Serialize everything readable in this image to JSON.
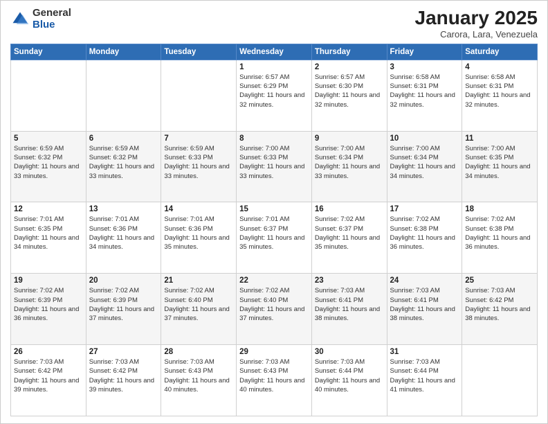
{
  "header": {
    "logo_general": "General",
    "logo_blue": "Blue",
    "month_title": "January 2025",
    "location": "Carora, Lara, Venezuela"
  },
  "weekdays": [
    "Sunday",
    "Monday",
    "Tuesday",
    "Wednesday",
    "Thursday",
    "Friday",
    "Saturday"
  ],
  "weeks": [
    [
      {
        "day": "",
        "sunrise": "",
        "sunset": "",
        "daylight": ""
      },
      {
        "day": "",
        "sunrise": "",
        "sunset": "",
        "daylight": ""
      },
      {
        "day": "",
        "sunrise": "",
        "sunset": "",
        "daylight": ""
      },
      {
        "day": "1",
        "sunrise": "Sunrise: 6:57 AM",
        "sunset": "Sunset: 6:29 PM",
        "daylight": "Daylight: 11 hours and 32 minutes."
      },
      {
        "day": "2",
        "sunrise": "Sunrise: 6:57 AM",
        "sunset": "Sunset: 6:30 PM",
        "daylight": "Daylight: 11 hours and 32 minutes."
      },
      {
        "day": "3",
        "sunrise": "Sunrise: 6:58 AM",
        "sunset": "Sunset: 6:31 PM",
        "daylight": "Daylight: 11 hours and 32 minutes."
      },
      {
        "day": "4",
        "sunrise": "Sunrise: 6:58 AM",
        "sunset": "Sunset: 6:31 PM",
        "daylight": "Daylight: 11 hours and 32 minutes."
      }
    ],
    [
      {
        "day": "5",
        "sunrise": "Sunrise: 6:59 AM",
        "sunset": "Sunset: 6:32 PM",
        "daylight": "Daylight: 11 hours and 33 minutes."
      },
      {
        "day": "6",
        "sunrise": "Sunrise: 6:59 AM",
        "sunset": "Sunset: 6:32 PM",
        "daylight": "Daylight: 11 hours and 33 minutes."
      },
      {
        "day": "7",
        "sunrise": "Sunrise: 6:59 AM",
        "sunset": "Sunset: 6:33 PM",
        "daylight": "Daylight: 11 hours and 33 minutes."
      },
      {
        "day": "8",
        "sunrise": "Sunrise: 7:00 AM",
        "sunset": "Sunset: 6:33 PM",
        "daylight": "Daylight: 11 hours and 33 minutes."
      },
      {
        "day": "9",
        "sunrise": "Sunrise: 7:00 AM",
        "sunset": "Sunset: 6:34 PM",
        "daylight": "Daylight: 11 hours and 33 minutes."
      },
      {
        "day": "10",
        "sunrise": "Sunrise: 7:00 AM",
        "sunset": "Sunset: 6:34 PM",
        "daylight": "Daylight: 11 hours and 34 minutes."
      },
      {
        "day": "11",
        "sunrise": "Sunrise: 7:00 AM",
        "sunset": "Sunset: 6:35 PM",
        "daylight": "Daylight: 11 hours and 34 minutes."
      }
    ],
    [
      {
        "day": "12",
        "sunrise": "Sunrise: 7:01 AM",
        "sunset": "Sunset: 6:35 PM",
        "daylight": "Daylight: 11 hours and 34 minutes."
      },
      {
        "day": "13",
        "sunrise": "Sunrise: 7:01 AM",
        "sunset": "Sunset: 6:36 PM",
        "daylight": "Daylight: 11 hours and 34 minutes."
      },
      {
        "day": "14",
        "sunrise": "Sunrise: 7:01 AM",
        "sunset": "Sunset: 6:36 PM",
        "daylight": "Daylight: 11 hours and 35 minutes."
      },
      {
        "day": "15",
        "sunrise": "Sunrise: 7:01 AM",
        "sunset": "Sunset: 6:37 PM",
        "daylight": "Daylight: 11 hours and 35 minutes."
      },
      {
        "day": "16",
        "sunrise": "Sunrise: 7:02 AM",
        "sunset": "Sunset: 6:37 PM",
        "daylight": "Daylight: 11 hours and 35 minutes."
      },
      {
        "day": "17",
        "sunrise": "Sunrise: 7:02 AM",
        "sunset": "Sunset: 6:38 PM",
        "daylight": "Daylight: 11 hours and 36 minutes."
      },
      {
        "day": "18",
        "sunrise": "Sunrise: 7:02 AM",
        "sunset": "Sunset: 6:38 PM",
        "daylight": "Daylight: 11 hours and 36 minutes."
      }
    ],
    [
      {
        "day": "19",
        "sunrise": "Sunrise: 7:02 AM",
        "sunset": "Sunset: 6:39 PM",
        "daylight": "Daylight: 11 hours and 36 minutes."
      },
      {
        "day": "20",
        "sunrise": "Sunrise: 7:02 AM",
        "sunset": "Sunset: 6:39 PM",
        "daylight": "Daylight: 11 hours and 37 minutes."
      },
      {
        "day": "21",
        "sunrise": "Sunrise: 7:02 AM",
        "sunset": "Sunset: 6:40 PM",
        "daylight": "Daylight: 11 hours and 37 minutes."
      },
      {
        "day": "22",
        "sunrise": "Sunrise: 7:02 AM",
        "sunset": "Sunset: 6:40 PM",
        "daylight": "Daylight: 11 hours and 37 minutes."
      },
      {
        "day": "23",
        "sunrise": "Sunrise: 7:03 AM",
        "sunset": "Sunset: 6:41 PM",
        "daylight": "Daylight: 11 hours and 38 minutes."
      },
      {
        "day": "24",
        "sunrise": "Sunrise: 7:03 AM",
        "sunset": "Sunset: 6:41 PM",
        "daylight": "Daylight: 11 hours and 38 minutes."
      },
      {
        "day": "25",
        "sunrise": "Sunrise: 7:03 AM",
        "sunset": "Sunset: 6:42 PM",
        "daylight": "Daylight: 11 hours and 38 minutes."
      }
    ],
    [
      {
        "day": "26",
        "sunrise": "Sunrise: 7:03 AM",
        "sunset": "Sunset: 6:42 PM",
        "daylight": "Daylight: 11 hours and 39 minutes."
      },
      {
        "day": "27",
        "sunrise": "Sunrise: 7:03 AM",
        "sunset": "Sunset: 6:42 PM",
        "daylight": "Daylight: 11 hours and 39 minutes."
      },
      {
        "day": "28",
        "sunrise": "Sunrise: 7:03 AM",
        "sunset": "Sunset: 6:43 PM",
        "daylight": "Daylight: 11 hours and 40 minutes."
      },
      {
        "day": "29",
        "sunrise": "Sunrise: 7:03 AM",
        "sunset": "Sunset: 6:43 PM",
        "daylight": "Daylight: 11 hours and 40 minutes."
      },
      {
        "day": "30",
        "sunrise": "Sunrise: 7:03 AM",
        "sunset": "Sunset: 6:44 PM",
        "daylight": "Daylight: 11 hours and 40 minutes."
      },
      {
        "day": "31",
        "sunrise": "Sunrise: 7:03 AM",
        "sunset": "Sunset: 6:44 PM",
        "daylight": "Daylight: 11 hours and 41 minutes."
      },
      {
        "day": "",
        "sunrise": "",
        "sunset": "",
        "daylight": ""
      }
    ]
  ]
}
